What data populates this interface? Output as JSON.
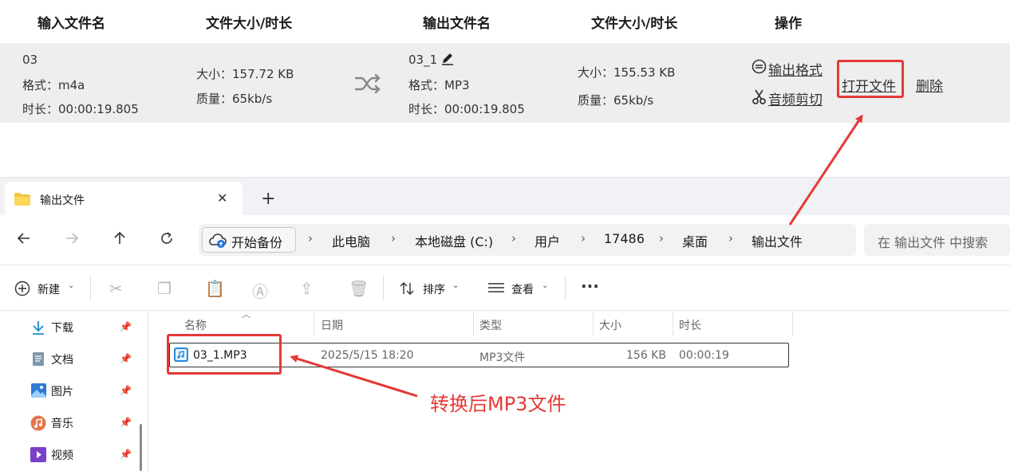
{
  "converter": {
    "headers": {
      "input_name": "输入文件名",
      "input_size": "文件大小/时长",
      "output_name": "输出文件名",
      "output_size": "文件大小/时长",
      "actions": "操作"
    },
    "row": {
      "input": {
        "name": "03",
        "format": "格式：m4a",
        "duration": "时长：00:00:19.805",
        "size": "大小：157.72 KB",
        "quality": "质量：65kb/s"
      },
      "output": {
        "name": "03_1",
        "format": "格式：MP3",
        "duration": "时长：00:00:19.805",
        "size": "大小：155.53 KB",
        "quality": "质量：65kb/s"
      },
      "actions": {
        "output_format": "输出格式",
        "audio_cut": "音频剪切",
        "open_file": "打开文件",
        "delete": "删除"
      }
    },
    "icons": {
      "shuffle": "shuffle-icon",
      "edit": "pencil-icon",
      "format": "format-icon",
      "cut": "scissors-icon"
    }
  },
  "explorer": {
    "tab": {
      "title": "输出文件",
      "close": "✕",
      "new_tab": "+"
    },
    "nav": {
      "backup": "开始备份",
      "breadcrumb": [
        "此电脑",
        "本地磁盘 (C:)",
        "用户",
        "17486",
        "桌面",
        "输出文件"
      ],
      "search_placeholder": "在 输出文件 中搜索"
    },
    "toolbar": {
      "new_label": "新建",
      "sort_label": "排序",
      "view_label": "查看",
      "more": "···"
    },
    "sidebar": [
      {
        "label": "下载",
        "icon": "download-icon"
      },
      {
        "label": "文档",
        "icon": "document-icon"
      },
      {
        "label": "图片",
        "icon": "picture-icon"
      },
      {
        "label": "音乐",
        "icon": "music-icon"
      },
      {
        "label": "视频",
        "icon": "video-icon"
      }
    ],
    "columns": {
      "name": "名称",
      "date": "日期",
      "type": "类型",
      "size": "大小",
      "duration": "时长"
    },
    "files": [
      {
        "name": "03_1.MP3",
        "date": "2025/5/15 18:20",
        "type": "MP3文件",
        "size": "156 KB",
        "duration": "00:00:19"
      }
    ]
  },
  "annotation": {
    "label": "转换后MP3文件",
    "color": "#e53935"
  },
  "colors": {
    "accent": "#3b7de0",
    "annotation_red": "#e53935",
    "row_bg": "#eeeeee"
  }
}
